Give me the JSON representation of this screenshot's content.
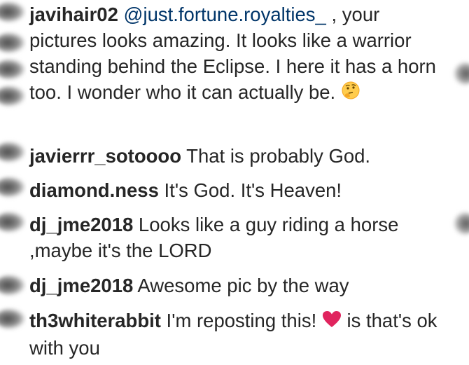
{
  "comments": [
    {
      "username": "javihair02",
      "mention": "@just.fortune.royalties_",
      "text_before": " , your pictures looks amazing. It looks like a warrior standing behind the Eclipse. I here it has a horn too. I wonder who it can actually be. ",
      "emoji": "thinking-face"
    },
    {
      "username": "javierrr_sotoooo",
      "text": " That is probably God."
    },
    {
      "username": "diamond.ness",
      "text": " It's God. It's Heaven!"
    },
    {
      "username": "dj_jme2018",
      "text": " Looks like a guy riding a horse ,maybe it's the LORD"
    },
    {
      "username": "dj_jme2018",
      "text": " Awesome pic by the way"
    },
    {
      "username": "th3whiterabbit",
      "text_before": " I'm reposting this! ",
      "emoji": "red-heart",
      "text_after": " is that's ok with you"
    }
  ],
  "colors": {
    "text": "#262626",
    "mention": "#003569",
    "heart": "#e0245e"
  }
}
